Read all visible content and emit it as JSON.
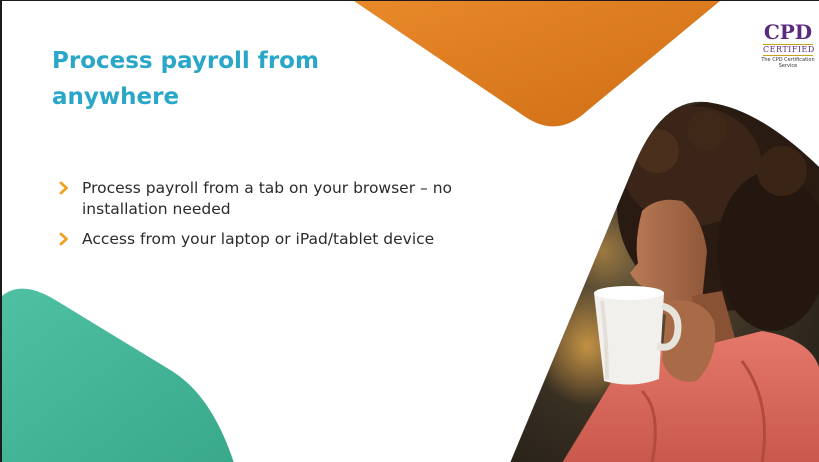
{
  "slide": {
    "title": "Process payroll from anywhere",
    "bullets": [
      "Process payroll from a tab on your browser – no installation needed",
      "Access from your laptop or iPad/tablet device"
    ]
  },
  "badge": {
    "logo_text": "CPD",
    "certified_text": "CERTIFIED",
    "service_text": "The CPD Certification Service"
  },
  "colors": {
    "title": "#2aa7c8",
    "bullet_arrow": "#f0a01e",
    "orange_shape": "#dd7c1c",
    "teal_shape": "#48b79a",
    "cpd_purple": "#5a2a7c",
    "cpd_gold": "#c9a21a"
  },
  "icons": {
    "bullet": "chevron-right-icon"
  }
}
